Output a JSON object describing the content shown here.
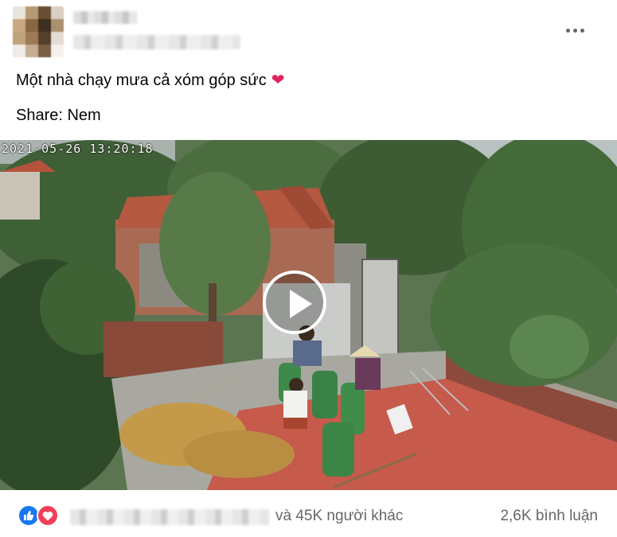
{
  "post": {
    "caption": "Một nhà chạy mưa cả xóm góp sức",
    "caption_emoji": "❤",
    "share_line": "Share: Nem"
  },
  "video": {
    "timestamp": "2021-05-26   13:20:18",
    "play_icon": "play-icon"
  },
  "footer": {
    "reaction_icons": [
      "like-icon",
      "love-icon"
    ],
    "others_text": "và 45K người khác",
    "comments_text": "2,6K bình luận"
  },
  "colors": {
    "like": "#1877f2",
    "love": "#f33e58",
    "secondary_text": "#65676b"
  }
}
